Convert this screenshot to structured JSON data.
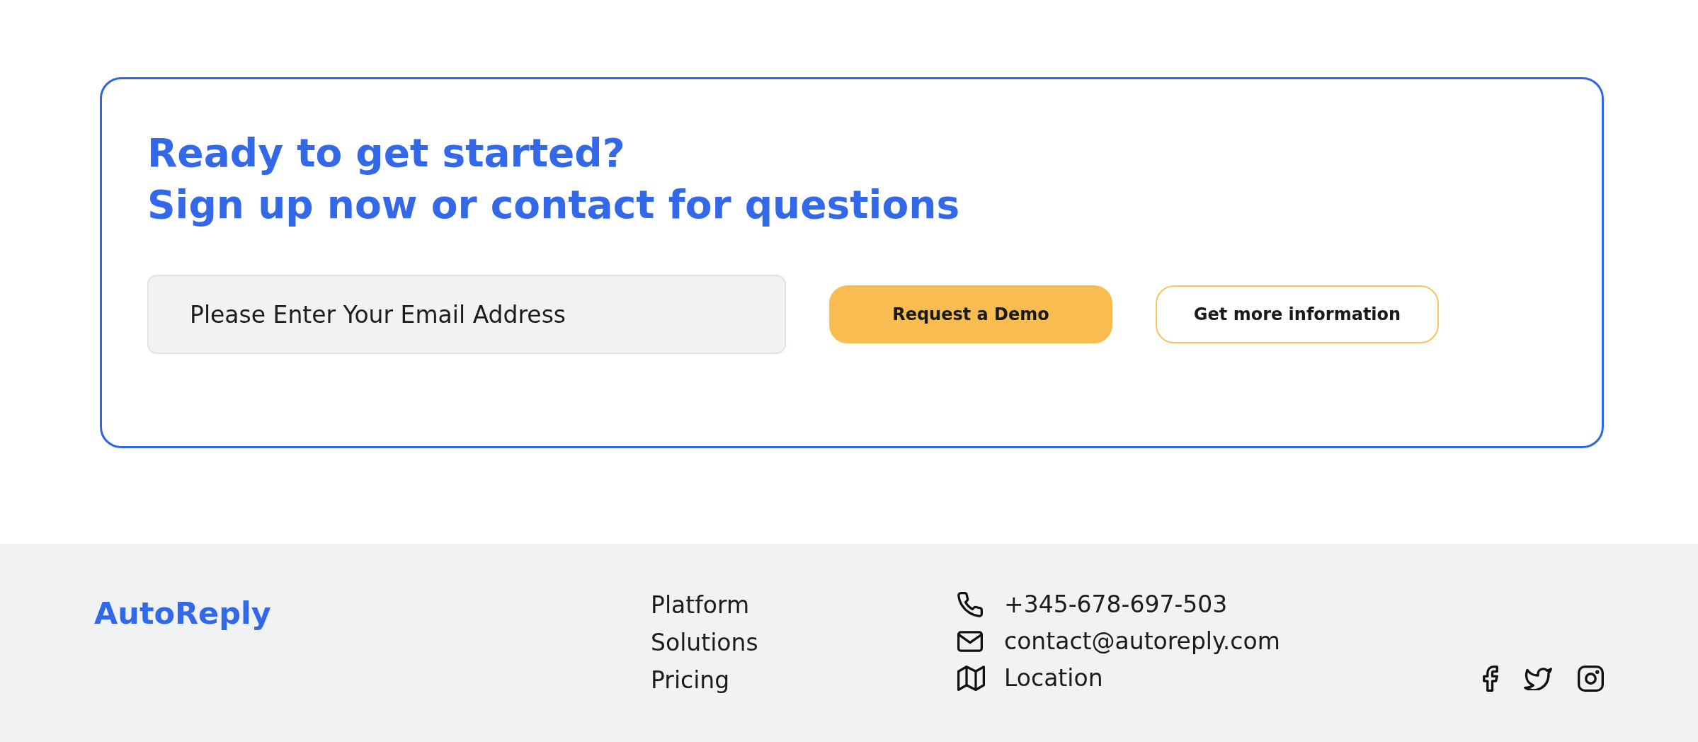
{
  "cta": {
    "title": "Ready to get started?",
    "subtitle": "Sign up now or contact for questions",
    "email_field": {
      "placeholder": "Please Enter Your Email Address"
    },
    "buttons": [
      {
        "label": "Request a Demo",
        "kind": "primary"
      },
      {
        "label": "Get more information",
        "kind": "outline"
      }
    ]
  },
  "footer": {
    "logo": "AutoReply",
    "links": [
      "Platform",
      "Solutions",
      "Pricing"
    ],
    "contacts": [
      {
        "kind": "phone",
        "text": "+345-678-697-503"
      },
      {
        "kind": "email",
        "text": "contact@autoreply.com"
      },
      {
        "kind": "location",
        "text": "Location"
      }
    ]
  }
}
